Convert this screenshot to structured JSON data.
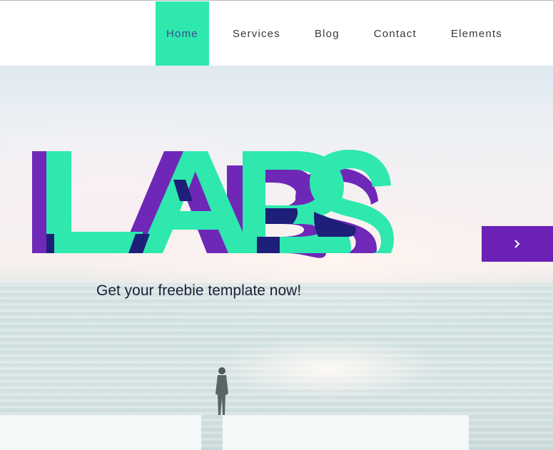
{
  "nav": {
    "items": [
      {
        "label": "Home",
        "active": true
      },
      {
        "label": "Services",
        "active": false
      },
      {
        "label": "Blog",
        "active": false
      },
      {
        "label": "Contact",
        "active": false
      },
      {
        "label": "Elements",
        "active": false
      }
    ]
  },
  "hero": {
    "logo_text": "LABS",
    "tagline": "Get your freebie template now!",
    "next_button_icon": "chevron-right-icon"
  },
  "colors": {
    "accent_green": "#2ee8ae",
    "accent_purple": "#6b21b6",
    "accent_navy": "#1e1f78"
  }
}
